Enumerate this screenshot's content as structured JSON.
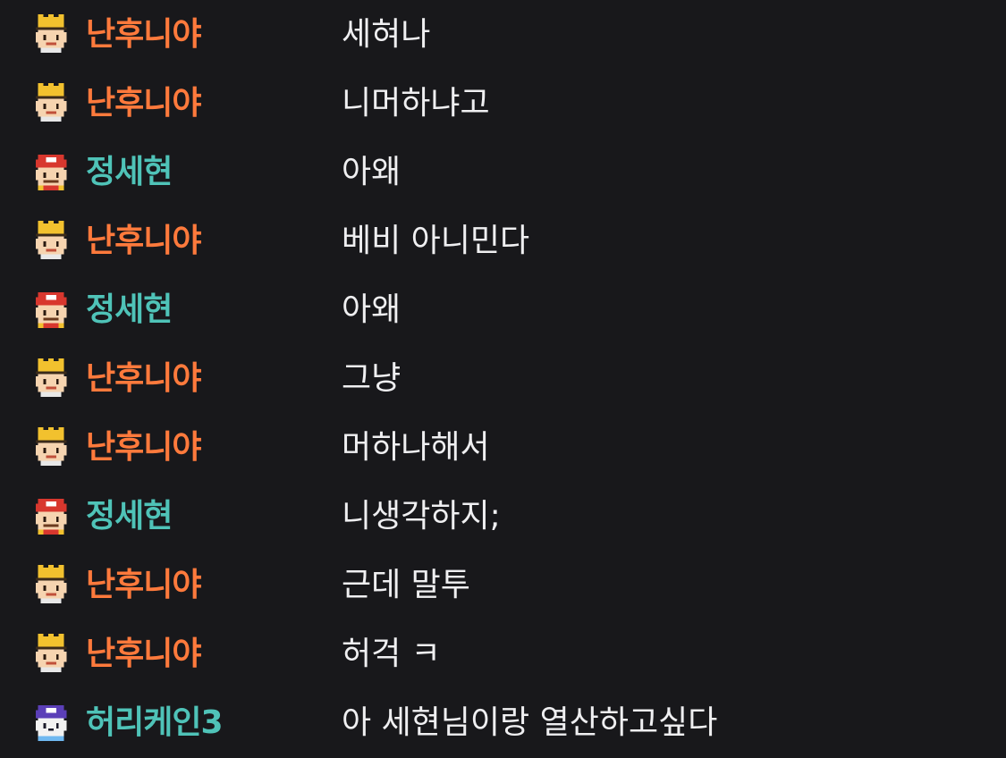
{
  "colors": {
    "background": "#18181b",
    "message_text": "#efeff1",
    "user_orange": "#ff7a3c",
    "user_teal": "#4fc3b8"
  },
  "messages": [
    {
      "user": "난후니야",
      "user_color": "#ff7a3c",
      "badge": "crown-badge-icon",
      "text": "세혀나"
    },
    {
      "user": "난후니야",
      "user_color": "#ff7a3c",
      "badge": "crown-badge-icon",
      "text": "니머하냐고"
    },
    {
      "user": "정세현",
      "user_color": "#4fc3b8",
      "badge": "mushroom-hat-badge-icon",
      "text": "아왜"
    },
    {
      "user": "난후니야",
      "user_color": "#ff7a3c",
      "badge": "crown-badge-icon",
      "text": "베비 아니민다"
    },
    {
      "user": "정세현",
      "user_color": "#4fc3b8",
      "badge": "mushroom-hat-badge-icon",
      "text": "아왜"
    },
    {
      "user": "난후니야",
      "user_color": "#ff7a3c",
      "badge": "crown-badge-icon",
      "text": "그냥"
    },
    {
      "user": "난후니야",
      "user_color": "#ff7a3c",
      "badge": "crown-badge-icon",
      "text": "머하나해서"
    },
    {
      "user": "정세현",
      "user_color": "#4fc3b8",
      "badge": "mushroom-hat-badge-icon",
      "text": "니생각하지;"
    },
    {
      "user": "난후니야",
      "user_color": "#ff7a3c",
      "badge": "crown-badge-icon",
      "text": "근데 말투"
    },
    {
      "user": "난후니야",
      "user_color": "#ff7a3c",
      "badge": "crown-badge-icon",
      "text": "허걱 ㅋ"
    },
    {
      "user": "허리케인3",
      "user_color": "#4fc3b8",
      "badge": "purple-hat-badge-icon",
      "text": "아 세현님이랑 열산하고싶다"
    }
  ]
}
